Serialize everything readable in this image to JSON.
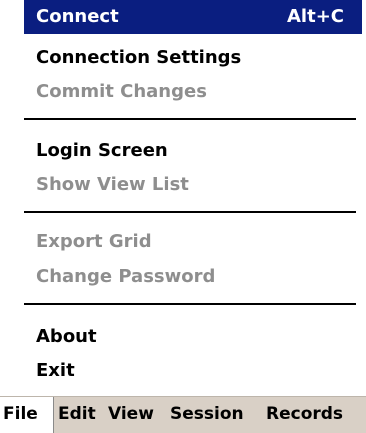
{
  "file_menu": {
    "items": [
      {
        "label": "Connect",
        "shortcut": "Alt+C",
        "enabled": true,
        "highlighted": true
      },
      {
        "label": "Connection Settings",
        "enabled": true
      },
      {
        "label": "Commit Changes",
        "enabled": false
      },
      {
        "label": "Login Screen",
        "enabled": true
      },
      {
        "label": "Show View List",
        "enabled": false
      },
      {
        "label": "Export Grid",
        "enabled": false
      },
      {
        "label": "Change Password",
        "enabled": false
      },
      {
        "label": "About",
        "enabled": true
      },
      {
        "label": "Exit",
        "enabled": true
      }
    ]
  },
  "menubar": {
    "items": [
      {
        "label": "File",
        "active": true
      },
      {
        "label": "Edit"
      },
      {
        "label": "View"
      },
      {
        "label": "Session"
      },
      {
        "label": "Records"
      }
    ]
  },
  "colors": {
    "highlight": "#0a1e80",
    "disabled_text": "#8e8e8e",
    "menubar_background": "#d9d0c6"
  }
}
